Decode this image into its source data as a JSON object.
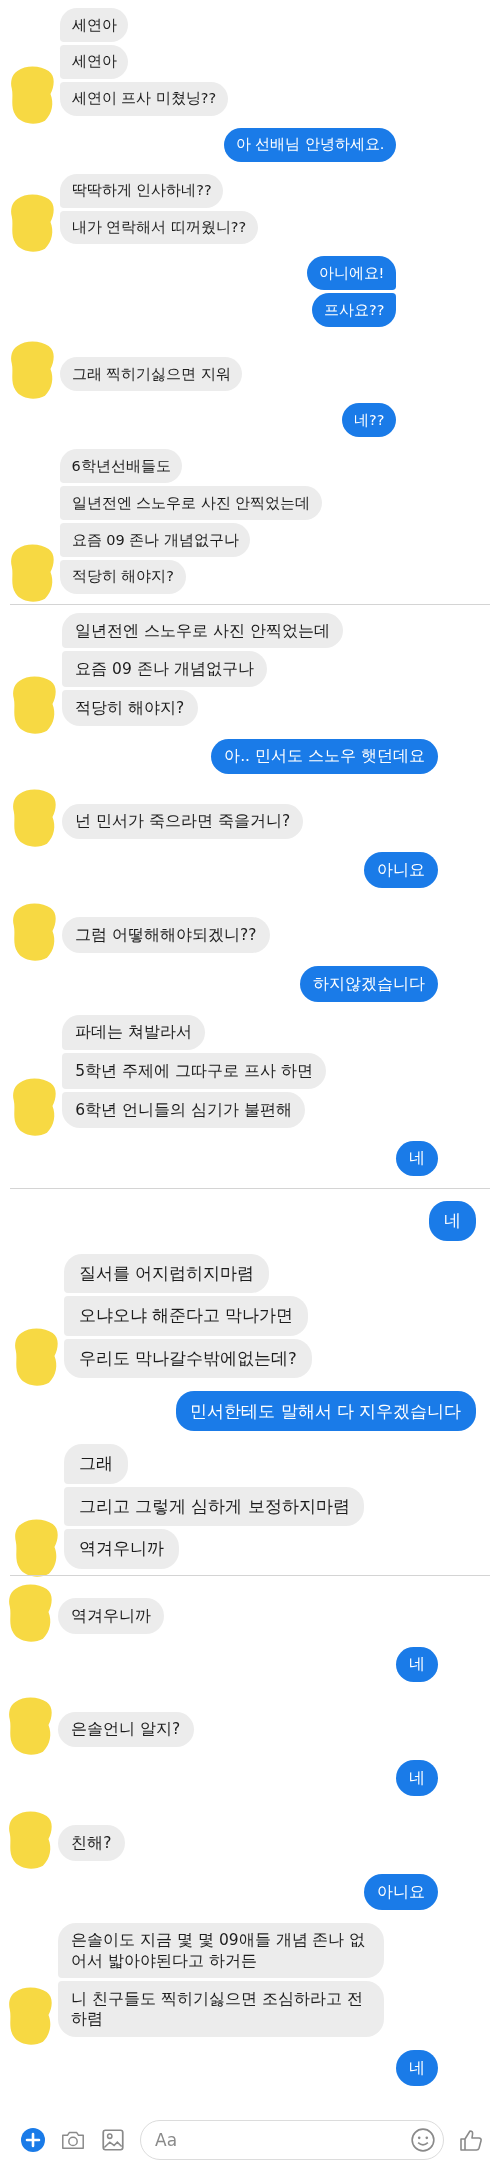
{
  "segments": [
    {
      "groups": [
        {
          "kind": "received",
          "messages": [
            "세연아",
            "세연아",
            "세연이 프사 미쳤닝??"
          ]
        },
        {
          "kind": "sent",
          "messages": [
            "아 선배님 안녕하세요."
          ]
        },
        {
          "kind": "received",
          "messages": [
            "딱딱하게 인사하네??",
            "내가 연락해서 띠꺼웠니??"
          ]
        },
        {
          "kind": "sent",
          "messages": [
            "아니에요!",
            "프사요??"
          ]
        },
        {
          "kind": "received",
          "messages": [
            "그래 찍히기싫으면 지워"
          ]
        },
        {
          "kind": "sent",
          "messages": [
            "네??"
          ]
        },
        {
          "kind": "received",
          "messages": [
            "6학년선배들도",
            "일년전엔 스노우로 사진 안찍었는데",
            "요즘 09 존나 개념없구나",
            "적당히 해야지?"
          ]
        }
      ]
    },
    {
      "groups": [
        {
          "kind": "received",
          "messages": [
            "일년전엔 스노우로 사진 안찍었는데",
            "요즘 09 존나 개념없구나",
            "적당히 해야지?"
          ]
        },
        {
          "kind": "sent",
          "messages": [
            "아.. 민서도 스노우 햇던데요"
          ]
        },
        {
          "kind": "received",
          "messages": [
            "넌 민서가 죽으라면 죽을거니?"
          ]
        },
        {
          "kind": "sent",
          "messages": [
            "아니요"
          ]
        },
        {
          "kind": "received",
          "messages": [
            "그럼 어떻해해야되겠니??"
          ]
        },
        {
          "kind": "sent",
          "messages": [
            "하지않겠습니다"
          ]
        },
        {
          "kind": "received",
          "messages": [
            "파데는 쳐발라서",
            "5학년 주제에 그따구로 프사 하면",
            "6학년 언니들의 심기가 불편해"
          ]
        },
        {
          "kind": "sent",
          "messages": [
            "네"
          ]
        }
      ]
    },
    {
      "groups": [
        {
          "kind": "sent",
          "messages": [
            "네"
          ]
        },
        {
          "kind": "received",
          "messages": [
            "질서를 어지럽히지마렴",
            "오냐오냐 해준다고 막나가면",
            "우리도 막나갈수밖에없는데?"
          ]
        },
        {
          "kind": "sent",
          "messages": [
            "민서한테도 말해서 다 지우겠습니다"
          ]
        },
        {
          "kind": "received",
          "messages": [
            "그래",
            "그리고 그렇게 심하게 보정하지마렴",
            "역겨우니까"
          ]
        }
      ]
    },
    {
      "groups": [
        {
          "kind": "received",
          "messages": [
            "역겨우니까"
          ]
        },
        {
          "kind": "sent",
          "messages": [
            "네"
          ]
        },
        {
          "kind": "received",
          "messages": [
            "은솔언니 알지?"
          ]
        },
        {
          "kind": "sent",
          "messages": [
            "네"
          ]
        },
        {
          "kind": "received",
          "messages": [
            "친해?"
          ]
        },
        {
          "kind": "sent",
          "messages": [
            "아니요"
          ]
        },
        {
          "kind": "received",
          "messages": [
            "은솔이도 지금 몇 몇 09애들 개념 존나 없어서 밟아야된다고 하거든",
            "니 친구들도 찍히기싫으면 조심하라고 전하렴"
          ]
        },
        {
          "kind": "sent",
          "messages": [
            "네"
          ]
        }
      ]
    }
  ],
  "composer": {
    "placeholder": "Aa"
  }
}
